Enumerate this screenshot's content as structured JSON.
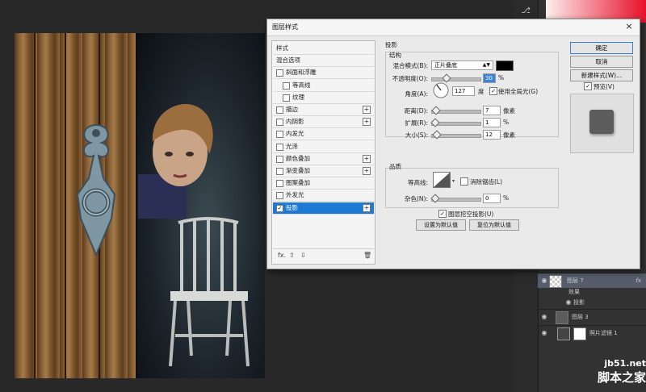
{
  "dialog": {
    "title": "图层样式",
    "close_glyph": "×",
    "buttons": {
      "ok": "确定",
      "cancel": "取消",
      "new_style": "新建样式(W)...",
      "preview": "预览(V)"
    },
    "preview_checked": true
  },
  "style_list": {
    "items": [
      {
        "label": "样式",
        "checkbox": false,
        "checked": false,
        "plus": false,
        "indent": 0
      },
      {
        "label": "混合选项",
        "checkbox": false,
        "checked": false,
        "plus": false,
        "indent": 0
      },
      {
        "label": "斜面和浮雕",
        "checkbox": true,
        "checked": false,
        "plus": false,
        "indent": 0
      },
      {
        "label": "等高线",
        "checkbox": true,
        "checked": false,
        "plus": false,
        "indent": 1
      },
      {
        "label": "纹理",
        "checkbox": true,
        "checked": false,
        "plus": false,
        "indent": 1
      },
      {
        "label": "描边",
        "checkbox": true,
        "checked": false,
        "plus": true,
        "indent": 0
      },
      {
        "label": "内阴影",
        "checkbox": true,
        "checked": false,
        "plus": true,
        "indent": 0
      },
      {
        "label": "内发光",
        "checkbox": true,
        "checked": false,
        "plus": false,
        "indent": 0
      },
      {
        "label": "光泽",
        "checkbox": true,
        "checked": false,
        "plus": false,
        "indent": 0
      },
      {
        "label": "颜色叠加",
        "checkbox": true,
        "checked": false,
        "plus": true,
        "indent": 0
      },
      {
        "label": "渐变叠加",
        "checkbox": true,
        "checked": false,
        "plus": true,
        "indent": 0
      },
      {
        "label": "图案叠加",
        "checkbox": true,
        "checked": false,
        "plus": false,
        "indent": 0
      },
      {
        "label": "外发光",
        "checkbox": true,
        "checked": false,
        "plus": false,
        "indent": 0
      },
      {
        "label": "投影",
        "checkbox": true,
        "checked": true,
        "plus": true,
        "indent": 0,
        "selected": true
      }
    ],
    "toolbar": {
      "fx": "fx.",
      "up": "⇧",
      "down": "⇩",
      "trash": "🗑"
    }
  },
  "drop_shadow": {
    "section_title": "投影",
    "structure": {
      "title": "结构",
      "blend_mode_label": "混合模式(B):",
      "blend_mode_value": "正片叠底",
      "blend_color": "#000000",
      "opacity_label": "不透明度(O):",
      "opacity_value": "30",
      "opacity_unit": "%",
      "angle_label": "角度(A):",
      "angle_value": "127",
      "angle_unit": "度",
      "global_light_label": "使用全局光(G)",
      "global_light_checked": true,
      "distance_label": "距离(D):",
      "distance_value": "7",
      "distance_unit": "像素",
      "spread_label": "扩展(R):",
      "spread_value": "1",
      "spread_unit": "%",
      "size_label": "大小(S):",
      "size_value": "12",
      "size_unit": "像素"
    },
    "quality": {
      "title": "品质",
      "contour_label": "等高线:",
      "antialias_label": "消除锯齿(L)",
      "antialias_checked": false,
      "noise_label": "杂色(N):",
      "noise_value": "0",
      "noise_unit": "%"
    },
    "knockout_label": "图层挖空投影(U)",
    "knockout_checked": true,
    "make_default": "设置为默认值",
    "reset_default": "复位为默认值"
  },
  "layers": [
    {
      "name": "图层 7",
      "fx": "fx",
      "selected": true
    },
    {
      "name": "效果",
      "sub": true
    },
    {
      "name": "投影",
      "sub": true
    },
    {
      "name": "图层 3"
    },
    {
      "name": "照片滤镜 1"
    }
  ],
  "watermark": {
    "url": "jb51.net",
    "title": "脚本之家"
  }
}
